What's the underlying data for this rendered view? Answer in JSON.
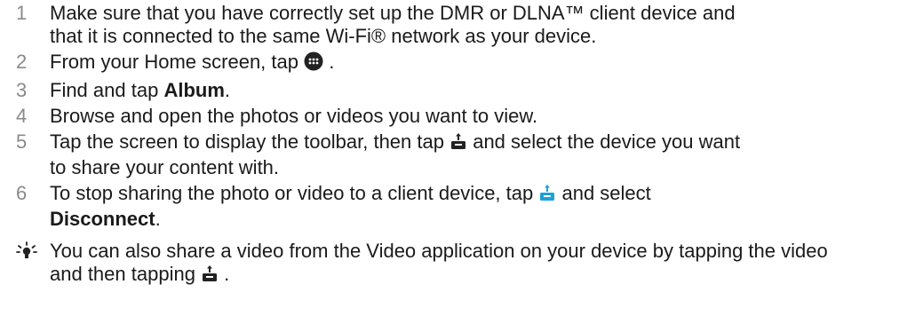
{
  "steps": [
    {
      "number": "1",
      "line1": "Make sure that you have correctly set up the DMR or DLNA™ client device and",
      "line2": "that it is connected to the same Wi-Fi® network as your device."
    },
    {
      "number": "2",
      "before": "From your Home screen, tap ",
      "icon": "apps-grid-icon",
      "after": "."
    },
    {
      "number": "3",
      "before": "Find and tap ",
      "bold": "Album",
      "after": "."
    },
    {
      "number": "4",
      "text": "Browse and open the photos or videos you want to view."
    },
    {
      "number": "5",
      "before": "Tap the screen to display the toolbar, then tap ",
      "icon": "cast-share-icon",
      "after": " and select the device you want",
      "line2": "to share your content with."
    },
    {
      "number": "6",
      "before": "To stop sharing the photo or video to a client device, tap ",
      "icon": "cast-share-active-icon",
      "after": " and select",
      "bold": "Disconnect",
      "after2": "."
    }
  ],
  "tip": {
    "icon": "lightbulb-tip-icon",
    "line1": "You can also share a video from the Video application on your device by tapping the video",
    "line2_before": "and then tapping ",
    "line2_icon": "cast-share-icon",
    "line2_after": "."
  },
  "colors": {
    "text": "#1a1a1a",
    "step_number": "#8a8a8a",
    "active_icon": "#1aa3d8"
  }
}
